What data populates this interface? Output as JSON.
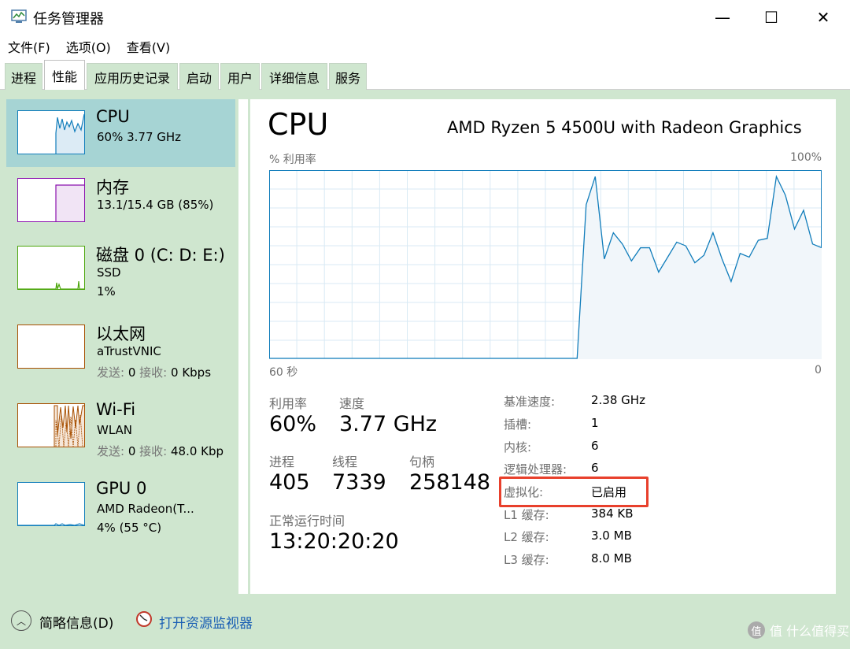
{
  "window": {
    "title": "任务管理器",
    "minimize": "—",
    "maximize": "☐",
    "close": "✕"
  },
  "menu": [
    "文件(F)",
    "选项(O)",
    "查看(V)"
  ],
  "tabs": [
    "进程",
    "性能",
    "应用历史记录",
    "启动",
    "用户",
    "详细信息",
    "服务"
  ],
  "active_tab": 1,
  "sidebar": {
    "cpu": {
      "title": "CPU",
      "sub1": "60%  3.77 GHz",
      "color": "#117dbb"
    },
    "memory": {
      "title": "内存",
      "sub1": "13.1/15.4 GB (85%)",
      "color": "#8b12ae"
    },
    "disk": {
      "title": "磁盘 0 (C: D: E:)",
      "sub1": "SSD",
      "sub2": "1%",
      "color": "#4da60c"
    },
    "ethernet": {
      "title": "以太网",
      "sub1": "aTrustVNIC",
      "send_label": "发送:",
      "send_value": "0",
      "recv_label": "接收:",
      "recv_value": "0 Kbps",
      "color": "#a74f01"
    },
    "wifi": {
      "title": "Wi-Fi",
      "sub1": "WLAN",
      "send_label": "发送:",
      "send_value": "0",
      "recv_label": "接收:",
      "recv_value": "48.0 Kbp",
      "color": "#a74f01"
    },
    "gpu": {
      "title": "GPU 0",
      "sub1": "AMD Radeon(T...",
      "sub2": "4% (55 °C)",
      "color": "#117dbb"
    }
  },
  "main": {
    "title": "CPU",
    "model": "AMD Ryzen 5 4500U with Radeon Graphics",
    "graph_label_left": "% 利用率",
    "graph_label_right": "100%",
    "time_left": "60 秒",
    "time_right": "0",
    "utilization_label": "利用率",
    "utilization_value": "60%",
    "speed_label": "速度",
    "speed_value": "3.77 GHz",
    "processes_label": "进程",
    "processes_value": "405",
    "threads_label": "线程",
    "threads_value": "7339",
    "handles_label": "句柄",
    "handles_value": "258148",
    "uptime_label": "正常运行时间",
    "uptime_value": "13:20:20:20",
    "details": [
      {
        "label": "基准速度:",
        "value": "2.38 GHz"
      },
      {
        "label": "插槽:",
        "value": "1"
      },
      {
        "label": "内核:",
        "value": "6"
      },
      {
        "label": "逻辑处理器:",
        "value": "6"
      },
      {
        "label": "虚拟化:",
        "value": "已启用"
      },
      {
        "label": "L1 缓存:",
        "value": "384 KB"
      },
      {
        "label": "L2 缓存:",
        "value": "3.0 MB"
      },
      {
        "label": "L3 缓存:",
        "value": "8.0 MB"
      }
    ],
    "cpu_usage_series": [
      0,
      0,
      0,
      0,
      0,
      0,
      0,
      0,
      0,
      0,
      0,
      0,
      0,
      0,
      0,
      0,
      0,
      0,
      0,
      0,
      0,
      0,
      0,
      0,
      0,
      0,
      0,
      0,
      0,
      0,
      0,
      0,
      0,
      0,
      0,
      82,
      97,
      53,
      67,
      61,
      52,
      59,
      59,
      46,
      54,
      62,
      60,
      51,
      55,
      67,
      53,
      41,
      56,
      54,
      63,
      64,
      97,
      87,
      69,
      79,
      61,
      59
    ]
  },
  "bottom": {
    "brief": "简略信息(D)",
    "monitor": "打开资源监视器",
    "watermark": "值 什么值得买"
  },
  "colors": {
    "cpu_line": "#117dbb",
    "cpu_fill": "#f1f6fa",
    "grid": "#d9eaf4",
    "highlight": "#e8402c"
  }
}
